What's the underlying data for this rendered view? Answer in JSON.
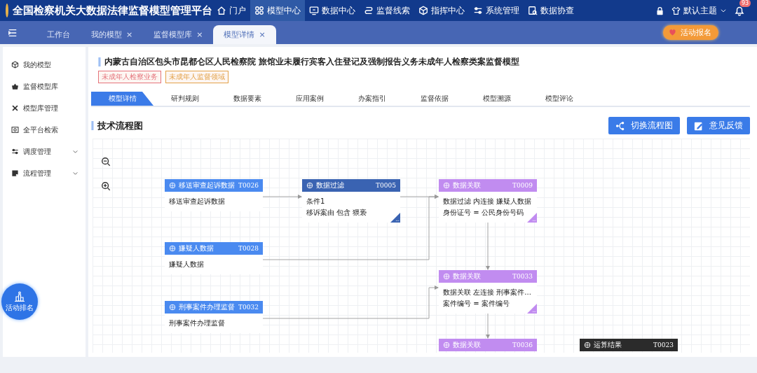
{
  "header": {
    "title": "全国检察机关大数据法律监督模型管理平台",
    "nav": [
      {
        "label": "门户",
        "selected": false
      },
      {
        "label": "模型中心",
        "selected": true
      },
      {
        "label": "数据中心",
        "selected": false
      },
      {
        "label": "监督线索",
        "selected": false
      },
      {
        "label": "指挥中心",
        "selected": false
      },
      {
        "label": "系统管理",
        "selected": false
      },
      {
        "label": "数据协查",
        "selected": false
      }
    ],
    "theme": "默认主题",
    "notification_count": "93"
  },
  "tabs": {
    "items": [
      {
        "label": "工作台",
        "closable": false,
        "selected": false
      },
      {
        "label": "我的模型",
        "closable": true,
        "selected": false
      },
      {
        "label": "监督模型库",
        "closable": true,
        "selected": false
      },
      {
        "label": "模型详情",
        "closable": true,
        "selected": true
      }
    ],
    "close_glyph": "×",
    "activity_button": "活动报名"
  },
  "sidebar": {
    "items": [
      {
        "label": "我的模型",
        "expandable": false
      },
      {
        "label": "监督模型库",
        "expandable": false
      },
      {
        "label": "模型库管理",
        "expandable": false
      },
      {
        "label": "全平台检索",
        "expandable": false
      },
      {
        "label": "调度管理",
        "expandable": true
      },
      {
        "label": "流程管理",
        "expandable": true
      }
    ],
    "ranking_button": "活动排名"
  },
  "model": {
    "title": "内蒙古自治区包头市昆都仑区人民检察院 旅馆业未履行宾客入住登记及强制报告义务未成年人检察类案监督模型",
    "tags": [
      {
        "label": "未成年人检察业务",
        "color": "#e5747c"
      },
      {
        "label": "未成年人监督领域",
        "color": "#e3a24a"
      }
    ]
  },
  "detail_tabs": [
    {
      "label": "模型详情",
      "selected": true
    },
    {
      "label": "研判规则",
      "selected": false
    },
    {
      "label": "数据要素",
      "selected": false
    },
    {
      "label": "应用案例",
      "selected": false
    },
    {
      "label": "办案指引",
      "selected": false
    },
    {
      "label": "监督依据",
      "selected": false
    },
    {
      "label": "模型溯源",
      "selected": false
    },
    {
      "label": "模型评论",
      "selected": false
    }
  ],
  "flow": {
    "title": "技术流程图",
    "buttons": [
      "切换流程图",
      "意见反馈"
    ],
    "nodes": [
      {
        "kind": "source",
        "name": "移送审查起诉数据",
        "code": "T0026",
        "lines": [
          "移送审查起诉数据"
        ]
      },
      {
        "kind": "filter",
        "name": "数据过滤",
        "code": "T0005",
        "lines": [
          "条件1",
          "移诉案由 包含 猥亵"
        ]
      },
      {
        "kind": "join",
        "name": "数据关联",
        "code": "T0009",
        "lines": [
          "数据过滤 内连接 嫌疑人数据",
          "身份证号 = 公民身份号码"
        ]
      },
      {
        "kind": "source",
        "name": "嫌疑人数据",
        "code": "T0028",
        "lines": [
          "嫌疑人数据"
        ]
      },
      {
        "kind": "source",
        "name": "刑事案件办理监督",
        "code": "T0032",
        "lines": [
          "刑事案件办理监督"
        ]
      },
      {
        "kind": "join",
        "name": "数据关联",
        "code": "T0033",
        "lines": [
          "数据关联 左连接 刑事案件...",
          "案件编号 = 案件编号"
        ]
      },
      {
        "kind": "join",
        "name": "数据关联",
        "code": "T0036"
      },
      {
        "kind": "result",
        "name": "运算结果",
        "code": "T0023"
      }
    ]
  }
}
